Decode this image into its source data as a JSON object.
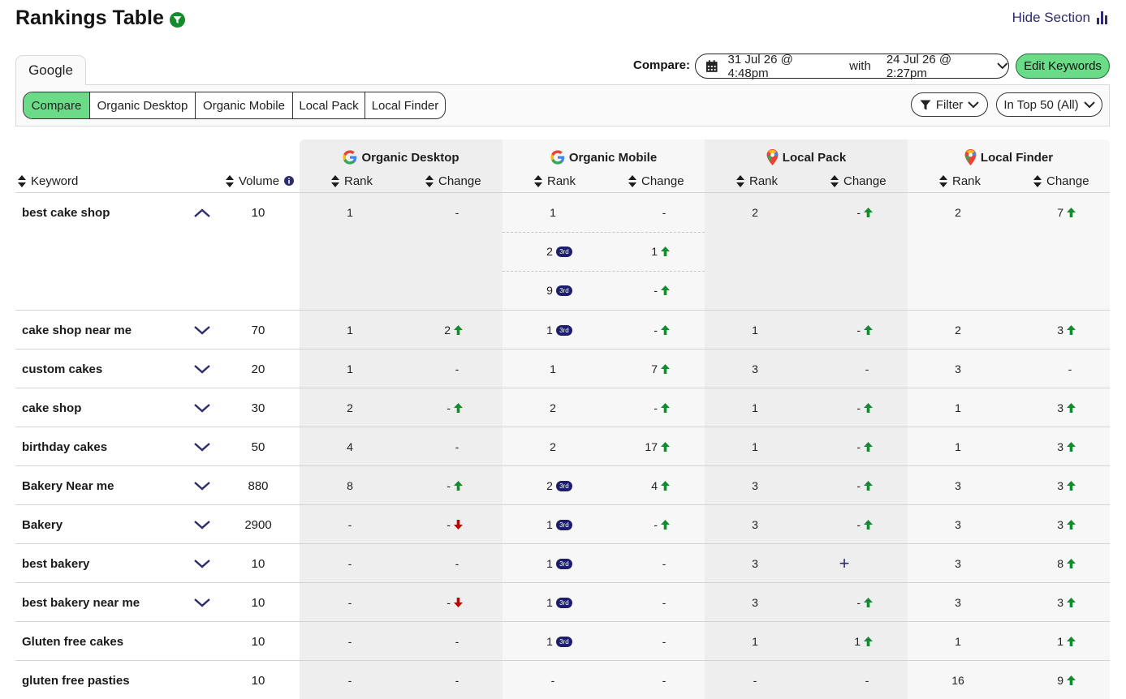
{
  "header": {
    "title": "Rankings Table",
    "hide_section": "Hide Section"
  },
  "tabs": {
    "google": "Google"
  },
  "compare": {
    "label": "Compare:",
    "date_from": "31 Jul 26 @ 4:48pm",
    "with": "with",
    "date_to": "24 Jul 26 @ 2:27pm"
  },
  "edit_keywords": "Edit Keywords",
  "segments": [
    "Compare",
    "Organic Desktop",
    "Organic Mobile",
    "Local Pack",
    "Local Finder"
  ],
  "filter_label": "Filter",
  "top_select": "In Top 50 (All)",
  "columns": {
    "keyword": "Keyword",
    "volume": "Volume",
    "rank": "Rank",
    "change": "Change",
    "groups": [
      "Organic Desktop",
      "Organic Mobile",
      "Local Pack",
      "Local Finder"
    ]
  },
  "colors": {
    "accent_green": "#6adc88",
    "up_arrow": "#148c2e",
    "down_arrow": "#c40000",
    "navy": "#1b1e6b"
  },
  "rows": [
    {
      "keyword": "best cake shop",
      "expanded": true,
      "volume": "10",
      "od": [
        "1",
        "-",
        ""
      ],
      "om": [
        "1",
        "-",
        ""
      ],
      "lp": [
        "2",
        "-",
        "up"
      ],
      "lf": [
        "2",
        "7",
        "up"
      ],
      "extra_mobile": [
        {
          "rank": "2",
          "badge": "3rd",
          "change": "1",
          "dir": "up"
        },
        {
          "rank": "9",
          "badge": "3rd",
          "change": "-",
          "dir": "up"
        }
      ]
    },
    {
      "keyword": "cake shop near me",
      "volume": "70",
      "od": [
        "1",
        "2",
        "up"
      ],
      "om": [
        "1",
        "-",
        "up",
        "3rd"
      ],
      "lp": [
        "1",
        "-",
        "up"
      ],
      "lf": [
        "2",
        "3",
        "up"
      ]
    },
    {
      "keyword": "custom cakes",
      "volume": "20",
      "od": [
        "1",
        "-",
        ""
      ],
      "om": [
        "1",
        "7",
        "up"
      ],
      "lp": [
        "3",
        "-",
        ""
      ],
      "lf": [
        "3",
        "-",
        ""
      ]
    },
    {
      "keyword": "cake shop",
      "volume": "30",
      "od": [
        "2",
        "-",
        "up"
      ],
      "om": [
        "2",
        "-",
        "up"
      ],
      "lp": [
        "1",
        "-",
        "up"
      ],
      "lf": [
        "1",
        "3",
        "up"
      ]
    },
    {
      "keyword": "birthday cakes",
      "volume": "50",
      "od": [
        "4",
        "-",
        ""
      ],
      "om": [
        "2",
        "17",
        "up"
      ],
      "lp": [
        "1",
        "-",
        "up"
      ],
      "lf": [
        "1",
        "3",
        "up"
      ]
    },
    {
      "keyword": "Bakery Near me",
      "volume": "880",
      "od": [
        "8",
        "-",
        "up"
      ],
      "om": [
        "2",
        "4",
        "up",
        "3rd"
      ],
      "lp": [
        "3",
        "-",
        "up"
      ],
      "lf": [
        "3",
        "3",
        "up"
      ]
    },
    {
      "keyword": "Bakery",
      "volume": "2900",
      "od": [
        "-",
        "-",
        "down"
      ],
      "om": [
        "1",
        "-",
        "up",
        "3rd"
      ],
      "lp": [
        "3",
        "-",
        "up"
      ],
      "lf": [
        "3",
        "3",
        "up"
      ]
    },
    {
      "keyword": "best bakery",
      "volume": "10",
      "od": [
        "-",
        "-",
        ""
      ],
      "om": [
        "1",
        "-",
        "",
        "3rd"
      ],
      "lp": [
        "3",
        "",
        "plus"
      ],
      "lf": [
        "3",
        "8",
        "up"
      ]
    },
    {
      "keyword": "best bakery near me",
      "volume": "10",
      "od": [
        "-",
        "-",
        "down"
      ],
      "om": [
        "1",
        "-",
        "",
        "3rd"
      ],
      "lp": [
        "3",
        "-",
        "up"
      ],
      "lf": [
        "3",
        "3",
        "up"
      ]
    },
    {
      "keyword": "Gluten free cakes",
      "nochevron": true,
      "volume": "10",
      "od": [
        "-",
        "-",
        ""
      ],
      "om": [
        "1",
        "-",
        "",
        "3rd"
      ],
      "lp": [
        "1",
        "1",
        "up"
      ],
      "lf": [
        "1",
        "1",
        "up"
      ]
    },
    {
      "keyword": "gluten free pasties",
      "nochevron": true,
      "volume": "10",
      "od": [
        "-",
        "-",
        ""
      ],
      "om": [
        "-",
        "-",
        ""
      ],
      "lp": [
        "-",
        "-",
        ""
      ],
      "lf": [
        "16",
        "9",
        "up"
      ]
    }
  ]
}
